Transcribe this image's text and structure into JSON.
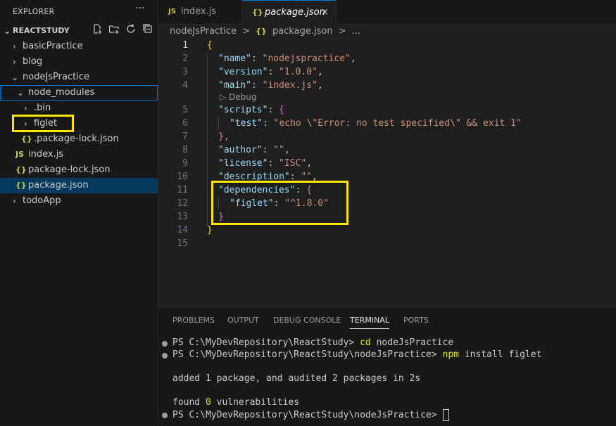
{
  "explorer": {
    "title": "EXPLORER",
    "more": "···",
    "root": "REACTSTUDY",
    "items": [
      {
        "label": "basicPractice"
      },
      {
        "label": "blog"
      },
      {
        "label": "nodeJsPractice"
      },
      {
        "label": "node_modules"
      },
      {
        "label": ".bin"
      },
      {
        "label": "figlet"
      },
      {
        "label": ".package-lock.json",
        "icon": "{}"
      },
      {
        "label": "index.js",
        "icon": "JS"
      },
      {
        "label": "package-lock.json",
        "icon": "{}"
      },
      {
        "label": "package.json",
        "icon": "{}"
      },
      {
        "label": "todoApp"
      }
    ]
  },
  "tabs": [
    {
      "label": "index.js",
      "icon": "JS"
    },
    {
      "label": "package.json",
      "icon": "{}",
      "close": "×"
    }
  ],
  "breadcrumb": {
    "folder": "nodeJsPractice",
    "sep": ">",
    "file": "package.json",
    "more": "..."
  },
  "code": {
    "line_numbers": [
      "1",
      "2",
      "3",
      "4",
      "5",
      "6",
      "7",
      "8",
      "9",
      "10",
      "11",
      "12",
      "13",
      "14",
      "15"
    ],
    "lines": [
      {
        "text": "{"
      },
      {
        "key": "\"name\"",
        "sep": ": ",
        "val": "\"nodejspractice\"",
        "end": ","
      },
      {
        "key": "\"version\"",
        "sep": ": ",
        "val": "\"1.0.0\"",
        "end": ","
      },
      {
        "key": "\"main\"",
        "sep": ": ",
        "val": "\"index.js\"",
        "end": ","
      },
      {
        "key": "\"scripts\"",
        "sep": ": ",
        "val": "{",
        "end": ""
      },
      {
        "key": "\"test\"",
        "sep": ": ",
        "val": "\"echo \\\"Error: no test specified\\\" && exit 1\"",
        "end": ""
      },
      {
        "text": "},"
      },
      {
        "key": "\"author\"",
        "sep": ": ",
        "val": "\"\"",
        "end": ","
      },
      {
        "key": "\"license\"",
        "sep": ": ",
        "val": "\"ISC\"",
        "end": ","
      },
      {
        "key": "\"description\"",
        "sep": ": ",
        "val": "\"\"",
        "end": ","
      },
      {
        "key": "\"dependencies\"",
        "sep": ": ",
        "val": "{",
        "end": ""
      },
      {
        "key": "\"figlet\"",
        "sep": ": ",
        "val": "\"^1.8.0\"",
        "end": ""
      },
      {
        "text": "}"
      },
      {
        "text": "}"
      }
    ],
    "debug_lens": "Debug"
  },
  "panel": {
    "tabs": [
      "PROBLEMS",
      "OUTPUT",
      "DEBUG CONSOLE",
      "TERMINAL",
      "PORTS"
    ],
    "active_tab": "TERMINAL",
    "terminal": [
      {
        "prompt": "PS C:\\MyDevRepository\\ReactStudy> ",
        "cmd": "cd",
        "args": " nodeJsPractice"
      },
      {
        "prompt": "PS C:\\MyDevRepository\\ReactStudy\\nodeJsPractice> ",
        "cmd": "npm",
        "args": " install figlet"
      },
      {
        "text": "added 1 package, and audited 2 packages in 2s"
      },
      {
        "pre": "found ",
        "num": "0",
        "post": " vulnerabilities"
      },
      {
        "prompt": "PS C:\\MyDevRepository\\ReactStudy\\nodeJsPractice> "
      }
    ]
  }
}
